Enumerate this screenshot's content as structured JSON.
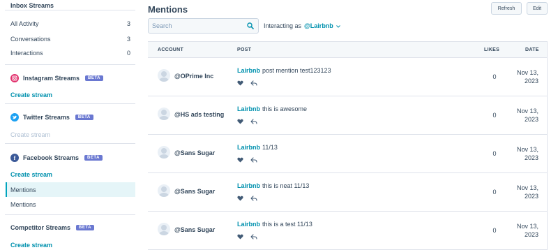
{
  "sidebar": {
    "inbox_heading": "Inbox Streams",
    "inbox_items": [
      {
        "label": "All Activity",
        "count": "3"
      },
      {
        "label": "Conversations",
        "count": "3"
      },
      {
        "label": "Interactions",
        "count": "0"
      }
    ],
    "instagram": {
      "label": "Instagram Streams",
      "beta": "BETA",
      "color": "#e1306c",
      "icon": "instagram-icon",
      "create": "Create stream"
    },
    "twitter": {
      "label": "Twitter Streams",
      "beta": "BETA",
      "color": "#1da1f2",
      "icon": "twitter-icon",
      "create": "Create stream"
    },
    "facebook": {
      "label": "Facebook Streams",
      "beta": "BETA",
      "color": "#3b5998",
      "icon": "facebook-icon",
      "create": "Create stream",
      "streams": [
        "Mentions",
        "Mentions"
      ]
    },
    "competitor": {
      "label": "Competitor Streams",
      "beta": "BETA",
      "create": "Create stream"
    }
  },
  "main": {
    "title": "Mentions",
    "refresh_label": "Refresh",
    "edit_label": "Edit",
    "search_placeholder": "Search",
    "interacting_prefix": "Interacting as",
    "interacting_handle": "@Lairbnb",
    "columns": {
      "account": "ACCOUNT",
      "post": "POST",
      "likes": "LIKES",
      "date": "DATE"
    },
    "rows": [
      {
        "account": "@OPrime Inc",
        "author": "Lairbnb",
        "text": "post mention test123123",
        "likes": "0",
        "date_line1": "Nov 13,",
        "date_line2": "2023"
      },
      {
        "account": "@HS ads testing",
        "author": "Lairbnb",
        "text": "this is awesome",
        "likes": "0",
        "date_line1": "Nov 13,",
        "date_line2": "2023"
      },
      {
        "account": "@Sans Sugar",
        "author": "Lairbnb",
        "text": "11/13",
        "likes": "0",
        "date_line1": "Nov 13,",
        "date_line2": "2023"
      },
      {
        "account": "@Sans Sugar",
        "author": "Lairbnb",
        "text": "this is neat 11/13",
        "likes": "0",
        "date_line1": "Nov 13,",
        "date_line2": "2023"
      },
      {
        "account": "@Sans Sugar",
        "author": "Lairbnb",
        "text": "this is a test 11/13",
        "likes": "0",
        "date_line1": "Nov 13,",
        "date_line2": "2023"
      }
    ]
  },
  "colors": {
    "accent": "#0091ae",
    "text": "#33475b",
    "beta": "#6a78d1",
    "active_bg": "#e5f5f8",
    "active_border": "#00a4bd"
  }
}
